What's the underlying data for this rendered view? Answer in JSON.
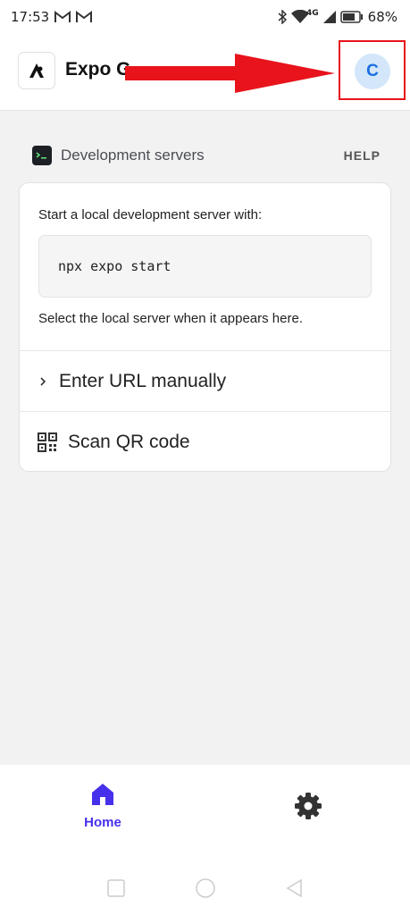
{
  "status_bar": {
    "time": "17:53",
    "network": "4G",
    "battery": "68%"
  },
  "app_bar": {
    "title": "Expo G",
    "avatar_initial": "C"
  },
  "section": {
    "title": "Development servers",
    "help": "HELP"
  },
  "card": {
    "intro": "Start a local development server with:",
    "command": "npx expo start",
    "hint": "Select the local server when it appears here.",
    "enter_url_label": "Enter URL manually",
    "scan_qr_label": "Scan QR code"
  },
  "bottom_nav": {
    "tabs": [
      {
        "label": "Home",
        "icon": "home-icon",
        "active": true
      },
      {
        "label": "",
        "icon": "gear-icon",
        "active": false
      }
    ]
  },
  "colors": {
    "accent": "#4630eb",
    "avatar_bg": "#d3e6fa",
    "avatar_fg": "#1a6fe0",
    "annotation_red": "#e8131b"
  }
}
